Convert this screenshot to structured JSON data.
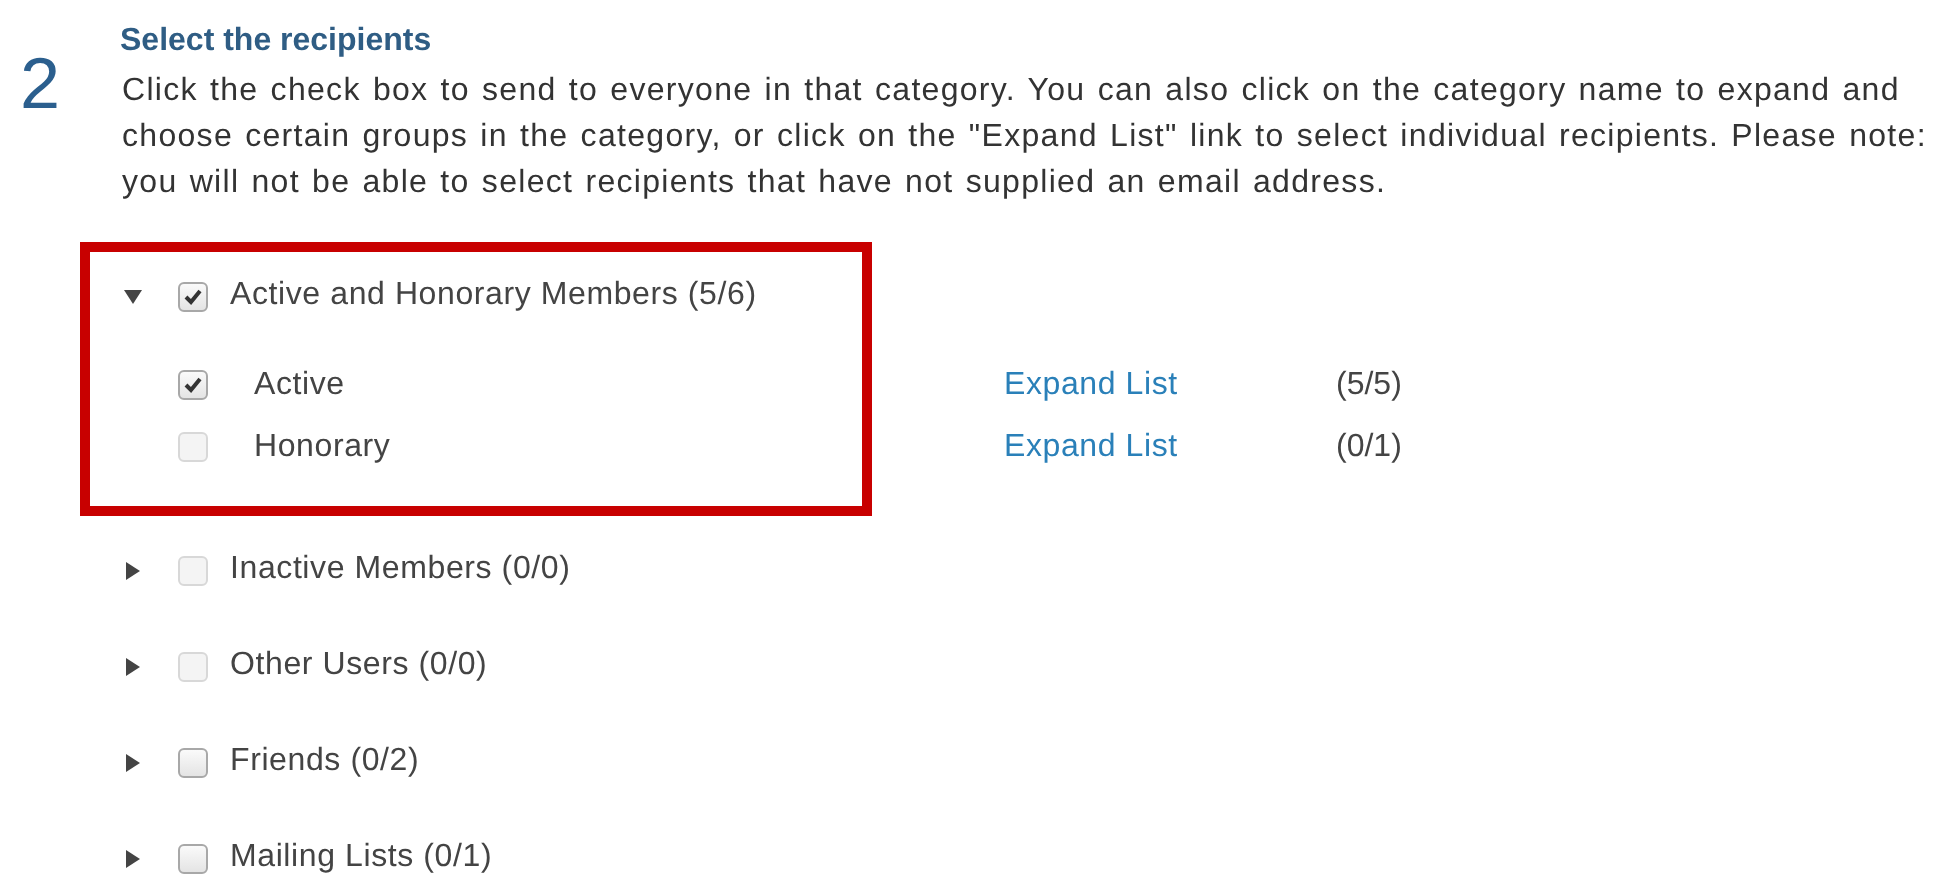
{
  "step": {
    "number": "2",
    "title": "Select the recipients",
    "instructions": "Click the check box to send to everyone in that category. You can also click on the category name to expand and choose certain groups in the category, or click on the \"Expand List\" link to select individual recipients. Please note: you will not be able to select recipients that have not supplied an email address."
  },
  "categories": [
    {
      "label": "Active and Honorary Members (5/6)",
      "expanded": true,
      "checked": true,
      "disabled": false,
      "highlighted": true,
      "groups": [
        {
          "label": "Active",
          "checked": true,
          "disabled": false,
          "link": "Expand List",
          "count": "(5/5)"
        },
        {
          "label": "Honorary",
          "checked": false,
          "disabled": true,
          "link": "Expand List",
          "count": "(0/1)"
        }
      ]
    },
    {
      "label": "Inactive Members (0/0)",
      "expanded": false,
      "checked": false,
      "disabled": true,
      "highlighted": false
    },
    {
      "label": "Other Users (0/0)",
      "expanded": false,
      "checked": false,
      "disabled": true,
      "highlighted": false
    },
    {
      "label": "Friends (0/2)",
      "expanded": false,
      "checked": false,
      "disabled": false,
      "highlighted": false
    },
    {
      "label": "Mailing Lists (0/1)",
      "expanded": false,
      "checked": false,
      "disabled": false,
      "highlighted": false
    }
  ]
}
